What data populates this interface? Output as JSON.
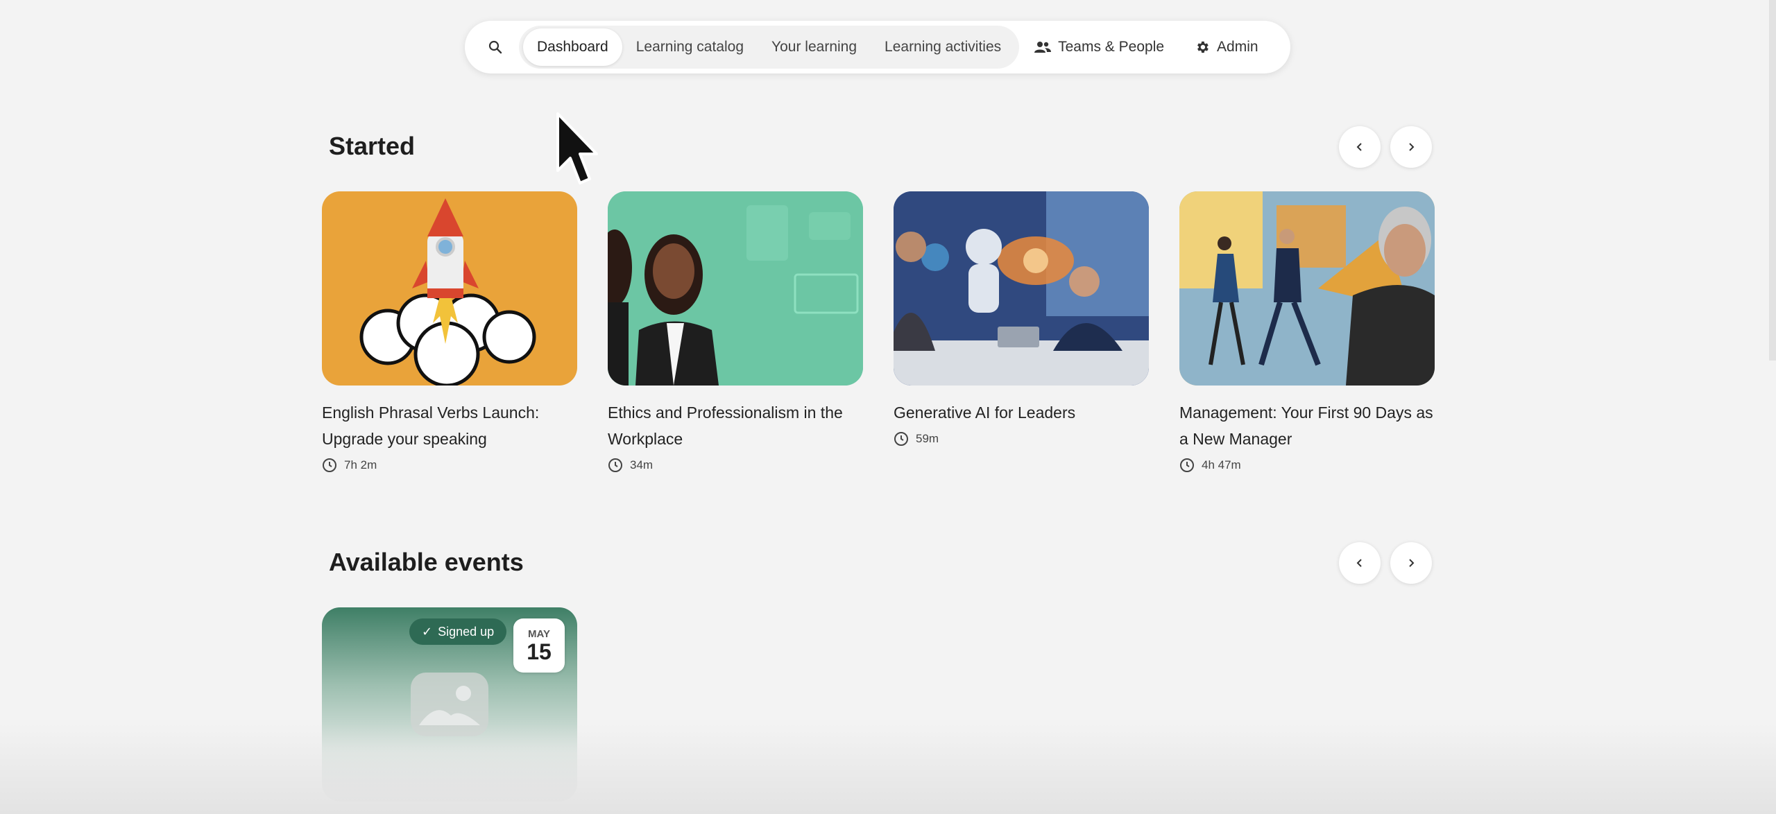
{
  "nav": {
    "search_icon": "search-icon",
    "tabs": [
      {
        "label": "Dashboard",
        "active": true
      },
      {
        "label": "Learning catalog",
        "active": false
      },
      {
        "label": "Your learning",
        "active": false
      },
      {
        "label": "Learning activities",
        "active": false
      }
    ],
    "teams": {
      "label": "Teams & People",
      "icon": "people-icon"
    },
    "admin": {
      "label": "Admin",
      "icon": "gear-icon"
    }
  },
  "started": {
    "title": "Started",
    "courses": [
      {
        "title": "English Phrasal Verbs Launch: Upgrade your speaking",
        "duration": "7h 2m",
        "thumb_color": "#E9A33A"
      },
      {
        "title": "Ethics and Professionalism in the Workplace",
        "duration": "34m",
        "thumb_color": "#6CC6A4"
      },
      {
        "title": "Generative AI for Leaders",
        "duration": "59m",
        "thumb_color": "#3B5FA8"
      },
      {
        "title": "Management: Your First 90 Days as a New Manager",
        "duration": "4h 47m",
        "thumb_color": "#E8C46A"
      }
    ]
  },
  "events": {
    "title": "Available events",
    "items": [
      {
        "badge": "Signed up",
        "month": "MAY",
        "day": "15"
      }
    ]
  }
}
